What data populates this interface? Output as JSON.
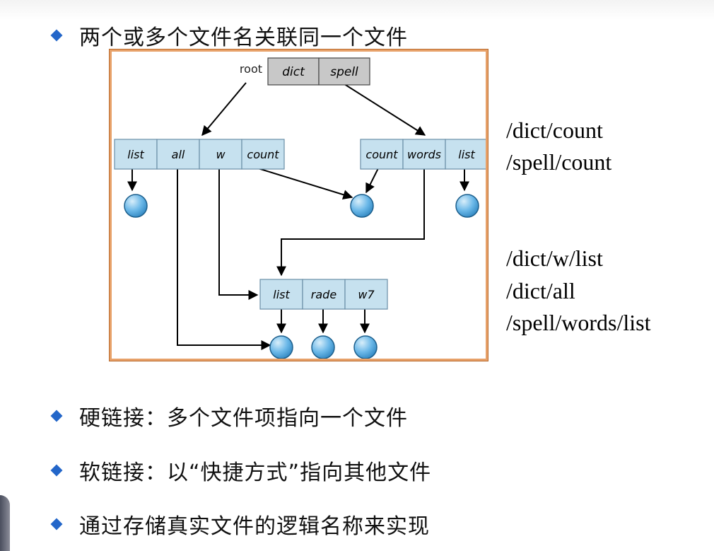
{
  "slide": {
    "bullet_top": "两个或多个文件名关联同一个文件",
    "bullet_1": "硬链接：多个文件项指向一个文件",
    "bullet_2": "软链接：以“快捷方式”指向其他文件",
    "bullet_3": "通过存储真实文件的逻辑名称来实现"
  },
  "paths": {
    "group_1": [
      "/dict/count",
      "/spell/count"
    ],
    "group_2": [
      "/dict/w/list",
      "/dict/all",
      "/spell/words/list"
    ]
  },
  "diagram": {
    "root_label": "root",
    "root_entries": [
      "dict",
      "spell"
    ],
    "dict_entries": [
      "list",
      "all",
      "w",
      "count"
    ],
    "spell_entries": [
      "count",
      "words",
      "list"
    ],
    "w_entries": [
      "list",
      "rade",
      "w7"
    ]
  },
  "colors": {
    "accent": "#2366c9",
    "frame": "#e7a169",
    "dir_box": "#c6e1ef",
    "root_box": "#c8c8c8",
    "file_node": "#5cb0e6"
  }
}
